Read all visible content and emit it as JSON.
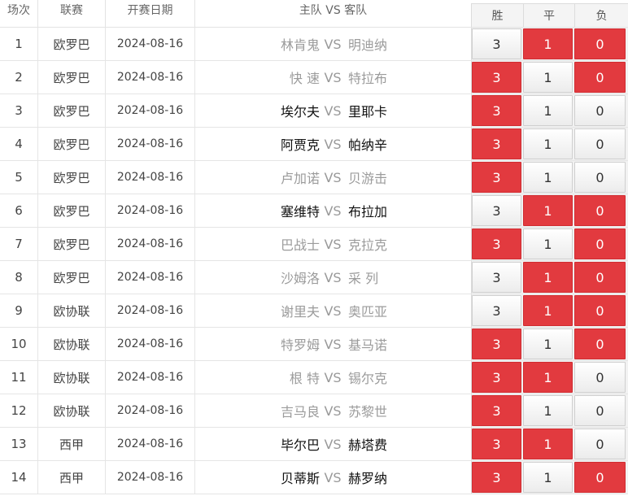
{
  "header": {
    "num": "场次",
    "league": "联赛",
    "date": "开赛日期",
    "teams": "主队 VS 客队",
    "win": "胜",
    "draw": "平",
    "lose": "负"
  },
  "vs": "VS",
  "rows": [
    {
      "num": "1",
      "league": "欧罗巴",
      "date": "2024-08-16",
      "home": "林肯鬼",
      "away": "明迪纳",
      "home_strong": false,
      "away_strong": false,
      "odds": [
        "3",
        "1",
        "0"
      ],
      "selected": [
        false,
        true,
        true
      ]
    },
    {
      "num": "2",
      "league": "欧罗巴",
      "date": "2024-08-16",
      "home": "快 速",
      "away": "特拉布",
      "home_strong": false,
      "away_strong": false,
      "odds": [
        "3",
        "1",
        "0"
      ],
      "selected": [
        true,
        false,
        true
      ]
    },
    {
      "num": "3",
      "league": "欧罗巴",
      "date": "2024-08-16",
      "home": "埃尔夫",
      "away": "里耶卡",
      "home_strong": true,
      "away_strong": true,
      "odds": [
        "3",
        "1",
        "0"
      ],
      "selected": [
        true,
        false,
        false
      ]
    },
    {
      "num": "4",
      "league": "欧罗巴",
      "date": "2024-08-16",
      "home": "阿贾克",
      "away": "帕纳辛",
      "home_strong": true,
      "away_strong": true,
      "odds": [
        "3",
        "1",
        "0"
      ],
      "selected": [
        true,
        false,
        false
      ]
    },
    {
      "num": "5",
      "league": "欧罗巴",
      "date": "2024-08-16",
      "home": "卢加诺",
      "away": "贝游击",
      "home_strong": false,
      "away_strong": false,
      "odds": [
        "3",
        "1",
        "0"
      ],
      "selected": [
        true,
        false,
        false
      ]
    },
    {
      "num": "6",
      "league": "欧罗巴",
      "date": "2024-08-16",
      "home": "塞维特",
      "away": "布拉加",
      "home_strong": true,
      "away_strong": true,
      "odds": [
        "3",
        "1",
        "0"
      ],
      "selected": [
        false,
        true,
        true
      ]
    },
    {
      "num": "7",
      "league": "欧罗巴",
      "date": "2024-08-16",
      "home": "巴战士",
      "away": "克拉克",
      "home_strong": false,
      "away_strong": false,
      "odds": [
        "3",
        "1",
        "0"
      ],
      "selected": [
        true,
        false,
        true
      ]
    },
    {
      "num": "8",
      "league": "欧罗巴",
      "date": "2024-08-16",
      "home": "沙姆洛",
      "away": "采 列",
      "home_strong": false,
      "away_strong": false,
      "odds": [
        "3",
        "1",
        "0"
      ],
      "selected": [
        false,
        true,
        true
      ]
    },
    {
      "num": "9",
      "league": "欧协联",
      "date": "2024-08-16",
      "home": "谢里夫",
      "away": "奥匹亚",
      "home_strong": false,
      "away_strong": false,
      "odds": [
        "3",
        "1",
        "0"
      ],
      "selected": [
        false,
        true,
        true
      ]
    },
    {
      "num": "10",
      "league": "欧协联",
      "date": "2024-08-16",
      "home": "特罗姆",
      "away": "基马诺",
      "home_strong": false,
      "away_strong": false,
      "odds": [
        "3",
        "1",
        "0"
      ],
      "selected": [
        true,
        false,
        true
      ]
    },
    {
      "num": "11",
      "league": "欧协联",
      "date": "2024-08-16",
      "home": "根 特",
      "away": "锡尔克",
      "home_strong": false,
      "away_strong": false,
      "odds": [
        "3",
        "1",
        "0"
      ],
      "selected": [
        true,
        true,
        false
      ]
    },
    {
      "num": "12",
      "league": "欧协联",
      "date": "2024-08-16",
      "home": "吉马良",
      "away": "苏黎世",
      "home_strong": false,
      "away_strong": false,
      "odds": [
        "3",
        "1",
        "0"
      ],
      "selected": [
        true,
        false,
        false
      ]
    },
    {
      "num": "13",
      "league": "西甲",
      "date": "2024-08-16",
      "home": "毕尔巴",
      "away": "赫塔费",
      "home_strong": true,
      "away_strong": true,
      "odds": [
        "3",
        "1",
        "0"
      ],
      "selected": [
        true,
        true,
        false
      ]
    },
    {
      "num": "14",
      "league": "西甲",
      "date": "2024-08-16",
      "home": "贝蒂斯",
      "away": "赫罗纳",
      "home_strong": true,
      "away_strong": true,
      "odds": [
        "3",
        "1",
        "0"
      ],
      "selected": [
        true,
        false,
        true
      ]
    }
  ],
  "colors": {
    "selected": "#e23a3f",
    "strong_team": "#111111",
    "weak_team": "#9b9b9b"
  }
}
